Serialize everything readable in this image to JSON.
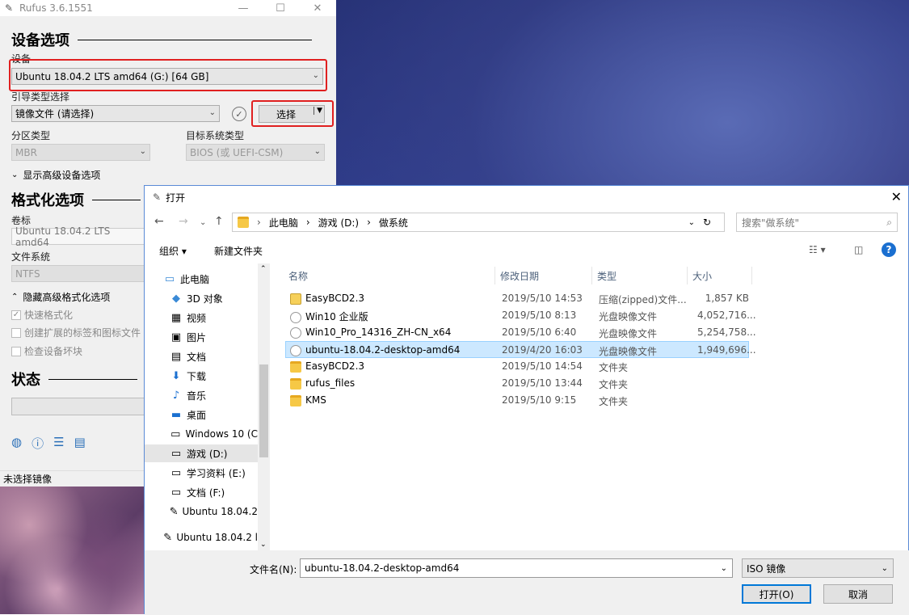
{
  "rufus": {
    "title": "Rufus 3.6.1551",
    "window_btns": [
      "—",
      "☐",
      "✕"
    ],
    "device_section": "设备选项",
    "device_label": "设备",
    "device_value": "Ubuntu 18.04.2 LTS amd64 (G:) [64 GB]",
    "boot_label": "引导类型选择",
    "boot_value": "镜像文件 (请选择)",
    "select_button": "选择",
    "partition_label": "分区类型",
    "partition_value": "MBR",
    "target_label": "目标系统类型",
    "target_value": "BIOS (或 UEFI-CSM)",
    "advanced_device": "显示高级设备选项",
    "format_section": "格式化选项",
    "volume_label": "卷标",
    "volume_value": "Ubuntu 18.04.2 LTS amd64",
    "fs_label": "文件系统",
    "fs_value": "NTFS",
    "advanced_format": "隐藏高级格式化选项",
    "quick_format": "快速格式化",
    "extended_label": "创建扩展的标签和图标文件",
    "check_bad": "检查设备坏块",
    "status_section": "状态",
    "status_text": "未选择镜像"
  },
  "dialog": {
    "title": "打开",
    "breadcrumb": [
      "此电脑",
      "›",
      "游戏 (D:)",
      "›",
      "做系统"
    ],
    "search_placeholder": "搜索\"做系统\"",
    "organize": "组织 ▾",
    "new_folder": "新建文件夹",
    "nav_items": [
      {
        "label": "此电脑",
        "icon": "computer-icon"
      },
      {
        "label": "3D 对象",
        "icon": "cube-icon"
      },
      {
        "label": "视频",
        "icon": "video-icon"
      },
      {
        "label": "图片",
        "icon": "picture-icon"
      },
      {
        "label": "文档",
        "icon": "document-icon"
      },
      {
        "label": "下载",
        "icon": "download-icon"
      },
      {
        "label": "音乐",
        "icon": "music-icon"
      },
      {
        "label": "桌面",
        "icon": "desktop-icon"
      },
      {
        "label": "Windows 10 (C",
        "icon": "drive-icon"
      },
      {
        "label": "游戏 (D:)",
        "icon": "drive-icon"
      },
      {
        "label": "学习资料 (E:)",
        "icon": "drive-icon"
      },
      {
        "label": "文档 (F:)",
        "icon": "drive-icon"
      },
      {
        "label": "Ubuntu 18.04.2",
        "icon": "usb-icon"
      },
      {
        "label": "Ubuntu 18.04.2 l",
        "icon": "usb-icon"
      }
    ],
    "columns": [
      "名称",
      "修改日期",
      "类型",
      "大小"
    ],
    "files": [
      {
        "name": "EasyBCD2.3",
        "date": "2019/5/10 14:53",
        "type": "压缩(zipped)文件...",
        "size": "1,857 KB",
        "kind": "zip"
      },
      {
        "name": "Win10 企业版",
        "date": "2019/5/10 8:13",
        "type": "光盘映像文件",
        "size": "4,052,716...",
        "kind": "disc"
      },
      {
        "name": "Win10_Pro_14316_ZH-CN_x64",
        "date": "2019/5/10 6:40",
        "type": "光盘映像文件",
        "size": "5,254,758...",
        "kind": "disc"
      },
      {
        "name": "ubuntu-18.04.2-desktop-amd64",
        "date": "2019/4/20 16:03",
        "type": "光盘映像文件",
        "size": "1,949,696...",
        "kind": "disc"
      },
      {
        "name": "EasyBCD2.3",
        "date": "2019/5/10 14:54",
        "type": "文件夹",
        "size": "",
        "kind": "folder"
      },
      {
        "name": "rufus_files",
        "date": "2019/5/10 13:44",
        "type": "文件夹",
        "size": "",
        "kind": "folder"
      },
      {
        "name": "KMS",
        "date": "2019/5/10 9:15",
        "type": "文件夹",
        "size": "",
        "kind": "folder"
      }
    ],
    "filename_label": "文件名(N):",
    "filename_value": "ubuntu-18.04.2-desktop-amd64",
    "filetype_value": "ISO 镜像",
    "open_button": "打开(O)",
    "cancel_button": "取消"
  }
}
